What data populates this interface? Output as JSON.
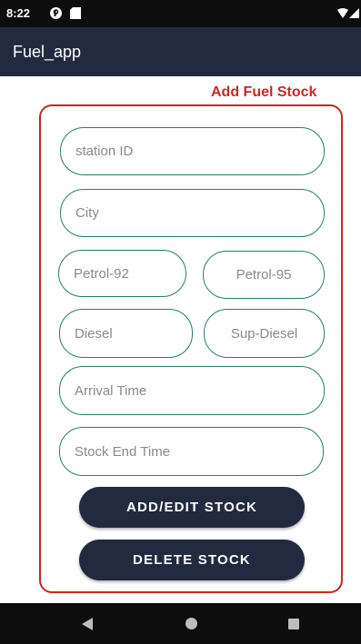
{
  "status_bar": {
    "time": "8:22"
  },
  "app_bar": {
    "title": "Fuel_app"
  },
  "form": {
    "title": "Add Fuel Stock",
    "station_id": {
      "placeholder": "station ID",
      "value": ""
    },
    "city": {
      "placeholder": "City",
      "value": ""
    },
    "petrol_92": {
      "placeholder": "Petrol-92",
      "value": ""
    },
    "petrol_95": {
      "placeholder": "Petrol-95",
      "value": ""
    },
    "diesel": {
      "placeholder": "Diesel",
      "value": ""
    },
    "sup_diesel": {
      "placeholder": "Sup-Diesel",
      "value": ""
    },
    "arrival_time": {
      "placeholder": "Arrival Time",
      "value": ""
    },
    "stock_end_time": {
      "placeholder": "Stock End Time",
      "value": ""
    },
    "add_edit_label": "ADD/EDIT STOCK",
    "delete_label": "DELETE STOCK"
  },
  "colors": {
    "app_bar": "#232a40",
    "accent_red": "#c62828",
    "field_border": "#2c7a73",
    "button": "#232a40"
  },
  "icons": {
    "status": [
      "notification-icon",
      "sd-card-icon",
      "wifi-icon",
      "signal-icon",
      "battery-icon"
    ],
    "nav": [
      "back-icon",
      "home-icon",
      "recent-apps-icon"
    ]
  }
}
